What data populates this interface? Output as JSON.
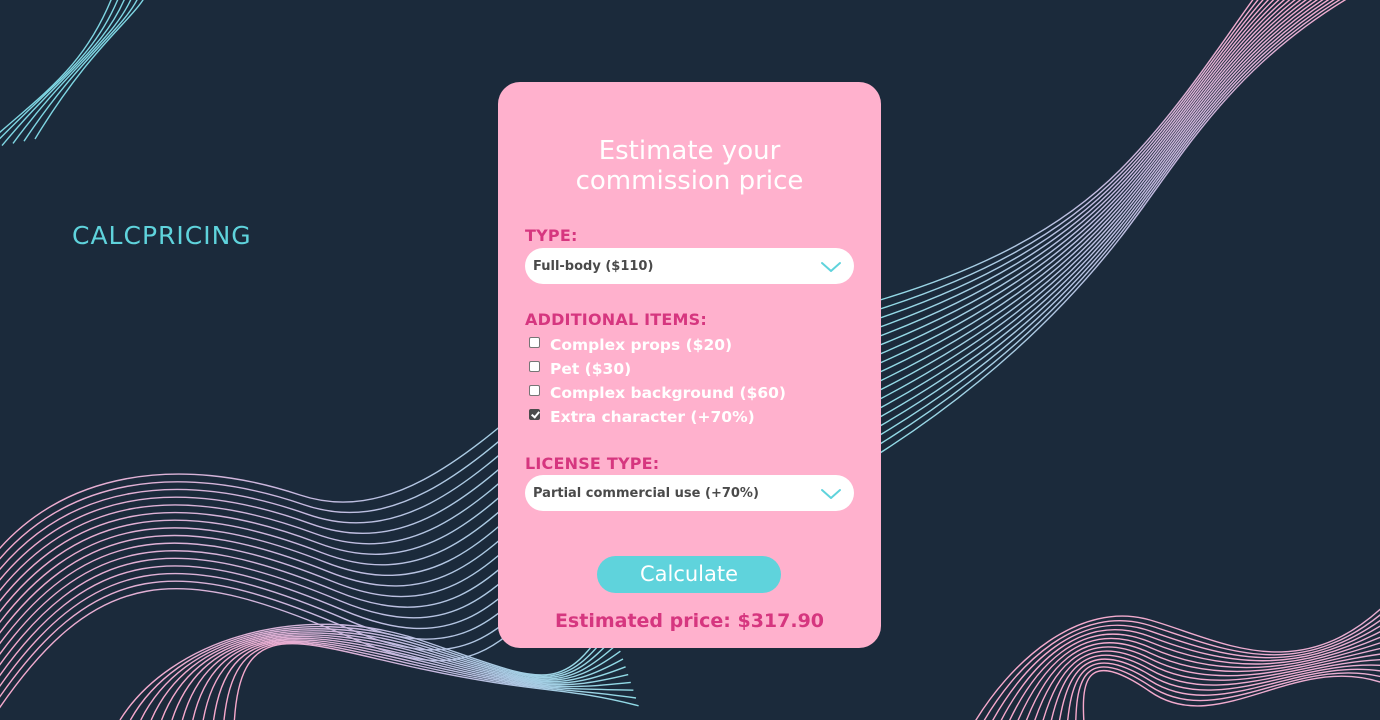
{
  "brand": {
    "name": "CALCPRICING"
  },
  "card": {
    "title_line1": "Estimate your",
    "title_line2": "commission price"
  },
  "type_section": {
    "label": "TYPE:",
    "selected": "Full-body ($110)",
    "icon": "chevron-down-icon"
  },
  "additional_items": {
    "label": "ADDITIONAL ITEMS:",
    "items": [
      {
        "label": "Complex props ($20)",
        "checked": false
      },
      {
        "label": "Pet ($30)",
        "checked": false
      },
      {
        "label": "Complex background ($60)",
        "checked": false
      },
      {
        "label": "Extra character (+70%)",
        "checked": true
      }
    ]
  },
  "license_section": {
    "label": "LICENSE TYPE:",
    "selected": "Partial commercial use (+70%)",
    "icon": "chevron-down-icon"
  },
  "actions": {
    "calculate_label": "Calculate"
  },
  "result": {
    "text": "Estimated price: $317.90"
  },
  "colors": {
    "background": "#1b2a3b",
    "card": "#ffb1cd",
    "accent_teal": "#5fd3dc",
    "accent_pink": "#d6367f",
    "wave_pink": "#f7a9cc"
  }
}
